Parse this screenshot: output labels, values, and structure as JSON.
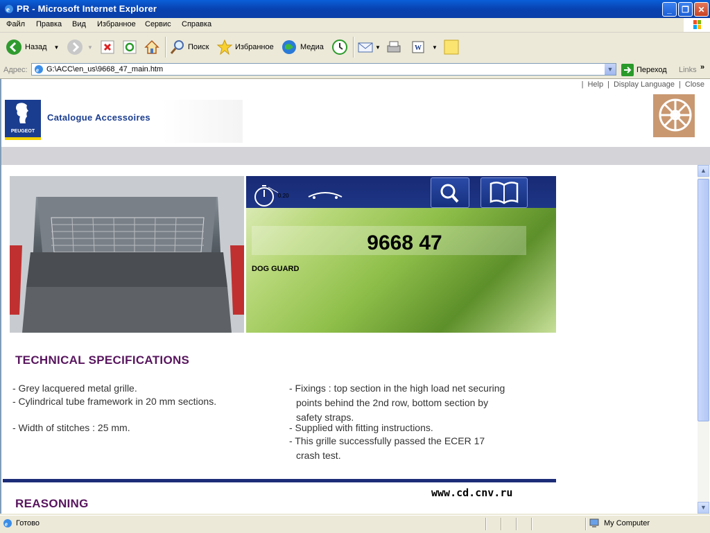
{
  "window": {
    "title": "PR - Microsoft Internet Explorer"
  },
  "menu": [
    "Файл",
    "Правка",
    "Вид",
    "Избранное",
    "Сервис",
    "Справка"
  ],
  "toolbar": {
    "back": "Назад",
    "search": "Поиск",
    "favorites": "Избранное",
    "media": "Медиа"
  },
  "address": {
    "label": "Адрес:",
    "url": "G:\\ACC\\en_us\\9668_47_main.htm",
    "go": "Переход",
    "links": "Links"
  },
  "page": {
    "links": {
      "help": "Help",
      "language": "Display Language",
      "close": "Close"
    },
    "catalogue_title": "Catalogue Accessoires",
    "logo_text": "PEUGEOT",
    "timer_label": "0.20",
    "part_number": "9668 47",
    "part_name": "DOG GUARD",
    "spec_heading": "TECHNICAL SPECIFICATIONS",
    "specs_left": [
      "- Grey lacquered metal grille.",
      "- Cylindrical tube framework in 20 mm sections.",
      "- Width of stitches : 25 mm."
    ],
    "specs_right": [
      "- Fixings : top section in the high load net securing",
      "points behind the 2nd row, bottom section by",
      "safety straps.",
      "- Supplied with fitting instructions.",
      "- This grille successfully passed the ECER 17",
      "crash test."
    ],
    "website": "www.cd.cnv.ru",
    "reasoning_heading": "REASONING"
  },
  "status": {
    "left": "Готово",
    "zone": "My Computer"
  }
}
